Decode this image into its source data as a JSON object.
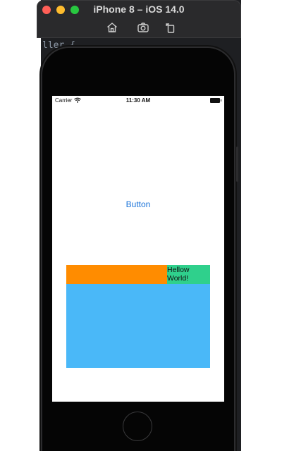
{
  "window": {
    "title": "iPhone 8 – iOS 14.0",
    "toolbar_icons": [
      "home-icon",
      "screenshot-icon",
      "rotate-icon"
    ]
  },
  "ide": {
    "code_fragment": "ller {"
  },
  "status_bar": {
    "carrier": "Carrier",
    "time": "11:30 AM"
  },
  "screen": {
    "button_label": "Button",
    "label_text": "Hellow\nWorld!"
  },
  "colors": {
    "orange_view": "#ff8c00",
    "green_view": "#2fd08c",
    "blue_view": "#4ab8f8",
    "button_tint": "#1a73d9"
  }
}
